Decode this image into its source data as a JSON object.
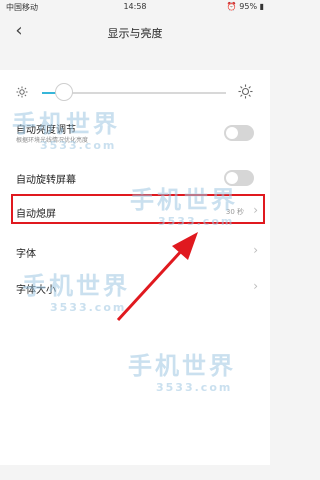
{
  "status_bar": {
    "carrier": "中国移动",
    "time": "14:58",
    "battery": "95%"
  },
  "header": {
    "title": "显示与亮度",
    "back_icon": "chevron-left-icon"
  },
  "brightness": {
    "level": 0.12,
    "min_icon": "sun-small-icon",
    "max_icon": "sun-large-icon",
    "accent": "#37b6d9"
  },
  "settings": {
    "auto_brightness": {
      "label": "自动亮度调节",
      "description": "根据环境光线情况优化亮度",
      "enabled": false
    },
    "auto_rotate": {
      "label": "自动旋转屏幕",
      "enabled": false
    },
    "screen_timeout": {
      "label": "自动熄屏",
      "value": "30 秒"
    },
    "font": {
      "label": "字体"
    },
    "font_size": {
      "label": "字体大小"
    }
  },
  "watermark": {
    "brand": "手机世界",
    "number": "3533.com"
  },
  "annotation": {
    "highlight_color": "#e0191f"
  }
}
